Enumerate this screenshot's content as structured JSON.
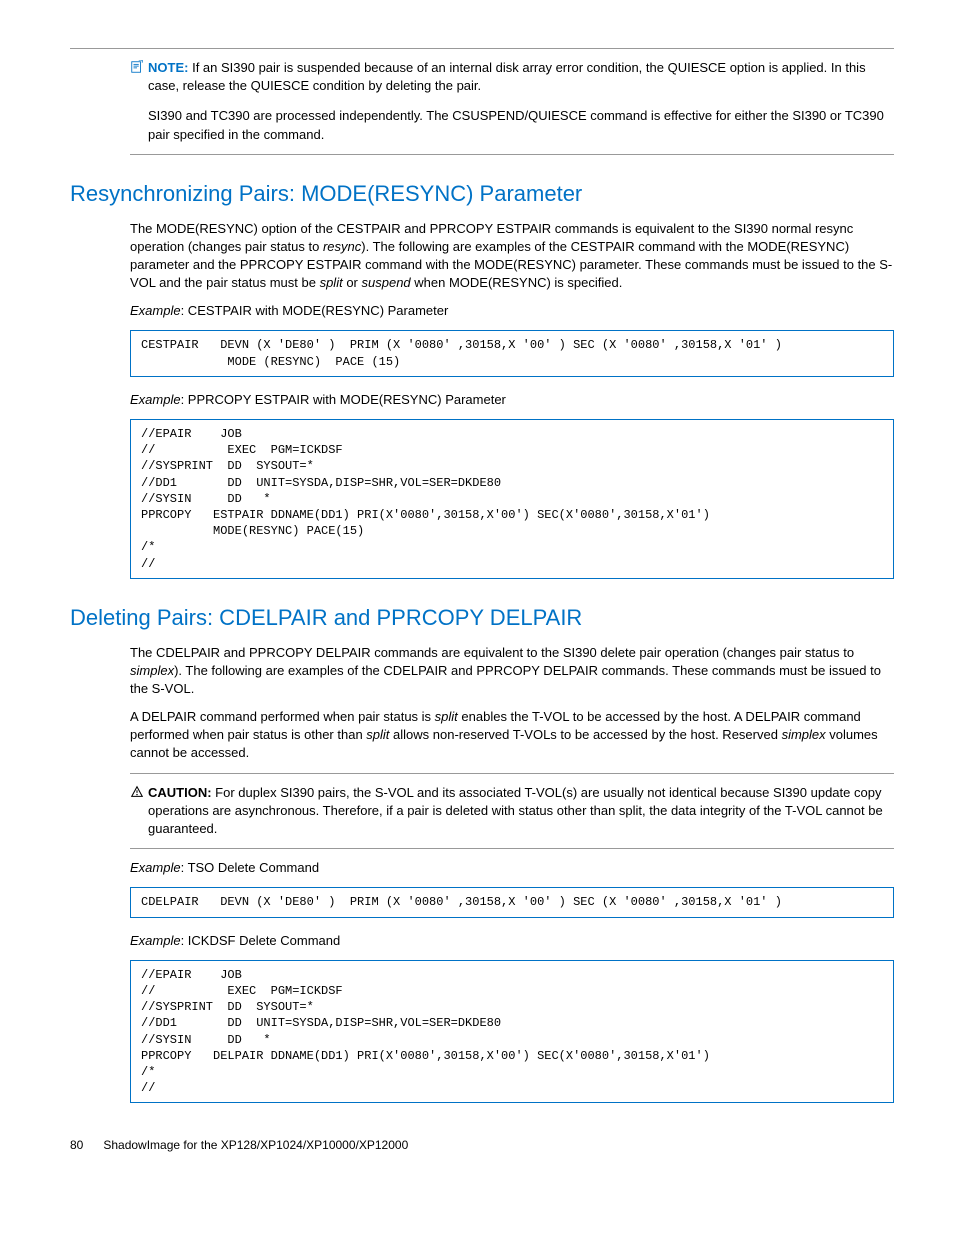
{
  "note1": {
    "label": "NOTE:",
    "text_a": "If an SI390 pair is suspended because of an internal disk array error condition, the QUIESCE option is applied. In this case, release the QUIESCE condition by deleting the pair.",
    "text_b": "SI390 and TC390 are processed independently. The CSUSPEND/QUIESCE command is effective for either the SI390 or TC390 pair specified in the command."
  },
  "section1": {
    "heading": "Resynchronizing Pairs: MODE(RESYNC) Parameter",
    "para": "The MODE(RESYNC) option of the CESTPAIR and PPRCOPY ESTPAIR commands is equivalent to the SI390 normal resync operation (changes pair status to resync). The following are examples of the CESTPAIR command with the MODE(RESYNC) parameter and the PPRCOPY ESTPAIR command with the MODE(RESYNC) parameter. These commands must be issued to the S-VOL and the pair status must be split or suspend when MODE(RESYNC) is specified.",
    "ex1_label": "Example",
    "ex1_rest": ": CESTPAIR with MODE(RESYNC) Parameter",
    "code1": "CESTPAIR   DEVN (X 'DE80' )  PRIM (X '0080' ,30158,X '00' ) SEC (X '0080' ,30158,X '01' )\n            MODE (RESYNC)  PACE (15)",
    "ex2_label": "Example",
    "ex2_rest": ": PPRCOPY ESTPAIR with MODE(RESYNC) Parameter",
    "code2": "//EPAIR    JOB\n//          EXEC  PGM=ICKDSF\n//SYSPRINT  DD  SYSOUT=*\n//DD1       DD  UNIT=SYSDA,DISP=SHR,VOL=SER=DKDE80\n//SYSIN     DD   *\nPPRCOPY   ESTPAIR DDNAME(DD1) PRI(X'0080',30158,X'00') SEC(X'0080',30158,X'01')\n          MODE(RESYNC) PACE(15)\n/*\n//"
  },
  "section2": {
    "heading": "Deleting Pairs: CDELPAIR and PPRCOPY DELPAIR",
    "para1": "The CDELPAIR and PPRCOPY DELPAIR commands are equivalent to the SI390 delete pair operation (changes pair status to simplex). The following are examples of the CDELPAIR and PPRCOPY DELPAIR commands. These commands must be issued to the S-VOL.",
    "para2": "A DELPAIR command performed when pair status is split enables the T-VOL to be accessed by the host. A DELPAIR command performed when pair status is other than split allows non-reserved T-VOLs to be accessed by the host. Reserved simplex volumes cannot be accessed.",
    "caution_label": "CAUTION:",
    "caution_text": "For duplex SI390 pairs, the S-VOL and its associated T-VOL(s) are usually not identical because SI390 update copy operations are asynchronous. Therefore, if a pair is deleted with status other than split, the data integrity of the T-VOL cannot be guaranteed.",
    "ex3_label": "Example",
    "ex3_rest": ": TSO Delete Command",
    "code3": "CDELPAIR   DEVN (X 'DE80' )  PRIM (X '0080' ,30158,X '00' ) SEC (X '0080' ,30158,X '01' )",
    "ex4_label": "Example",
    "ex4_rest": ": ICKDSF Delete Command",
    "code4": "//EPAIR    JOB\n//          EXEC  PGM=ICKDSF\n//SYSPRINT  DD  SYSOUT=*\n//DD1       DD  UNIT=SYSDA,DISP=SHR,VOL=SER=DKDE80\n//SYSIN     DD   *\nPPRCOPY   DELPAIR DDNAME(DD1) PRI(X'0080',30158,X'00') SEC(X'0080',30158,X'01')\n/*\n//"
  },
  "footer": {
    "page": "80",
    "title": "ShadowImage for the XP128/XP1024/XP10000/XP12000"
  }
}
